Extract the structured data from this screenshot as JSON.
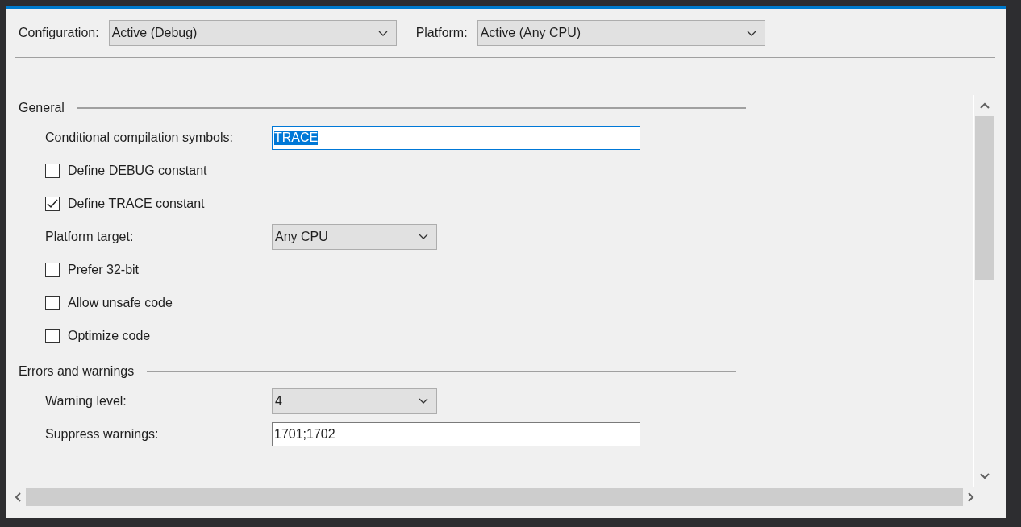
{
  "toolbar": {
    "configuration": {
      "label": "Configuration:",
      "value": "Active (Debug)"
    },
    "platform": {
      "label": "Platform:",
      "value": "Active (Any CPU)"
    }
  },
  "sections": [
    {
      "title": "General",
      "items": [
        {
          "kind": "text",
          "label": "Conditional compilation symbols:",
          "value": "TRACE",
          "focused": true,
          "value_selected": true
        },
        {
          "kind": "checkbox",
          "label": "Define DEBUG constant",
          "checked": false
        },
        {
          "kind": "checkbox",
          "label": "Define TRACE constant",
          "checked": true
        },
        {
          "kind": "dropdown",
          "label": "Platform target:",
          "value": "Any CPU"
        },
        {
          "kind": "checkbox",
          "label": "Prefer 32-bit",
          "checked": false
        },
        {
          "kind": "checkbox",
          "label": "Allow unsafe code",
          "checked": false
        },
        {
          "kind": "checkbox",
          "label": "Optimize code",
          "checked": false
        }
      ]
    },
    {
      "title": "Errors and warnings",
      "items": [
        {
          "kind": "dropdown",
          "label": "Warning level:",
          "value": "4"
        },
        {
          "kind": "text",
          "label": "Suppress warnings:",
          "value": "1701;1702",
          "focused": false,
          "value_selected": false
        }
      ]
    }
  ]
}
